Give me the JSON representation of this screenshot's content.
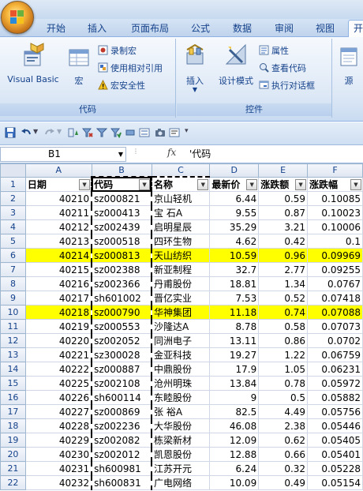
{
  "ribbon_tabs": [
    {
      "label": "开始"
    },
    {
      "label": "插入"
    },
    {
      "label": "页面布局"
    },
    {
      "label": "公式"
    },
    {
      "label": "数据"
    },
    {
      "label": "审阅"
    },
    {
      "label": "视图"
    },
    {
      "label": "开"
    }
  ],
  "ribbon": {
    "code_group": {
      "label": "代码",
      "visual_basic": "Visual Basic",
      "macros": "宏",
      "record_macro": "录制宏",
      "relative_ref": "使用相对引用",
      "macro_security": "宏安全性"
    },
    "controls_group": {
      "label": "控件",
      "insert": "插入",
      "design_mode": "设计模式",
      "properties": "属性",
      "view_code": "查看代码",
      "run_dialog": "执行对话框"
    },
    "source_group": {
      "source": "源"
    }
  },
  "formula_bar": {
    "name_box": "B1",
    "fx": "fx",
    "formula": "'代码"
  },
  "columns": [
    "A",
    "B",
    "C",
    "D",
    "E",
    "F"
  ],
  "headers": [
    "日期",
    "代码",
    "名称",
    "最新价",
    "涨跌额",
    "涨跌幅"
  ],
  "rows": [
    {
      "n": "2",
      "cells": [
        "40210",
        "sz000821",
        "京山轻机",
        "6.44",
        "0.59",
        "0.10085"
      ],
      "hl": false
    },
    {
      "n": "3",
      "cells": [
        "40211",
        "sz000413",
        "宝 石A",
        "9.55",
        "0.87",
        "0.10023"
      ],
      "hl": false
    },
    {
      "n": "4",
      "cells": [
        "40212",
        "sz002439",
        "启明星辰",
        "35.29",
        "3.21",
        "0.10006"
      ],
      "hl": false
    },
    {
      "n": "5",
      "cells": [
        "40213",
        "sz000518",
        "四环生物",
        "4.62",
        "0.42",
        "0.1"
      ],
      "hl": false
    },
    {
      "n": "6",
      "cells": [
        "40214",
        "sz000813",
        "天山纺织",
        "10.59",
        "0.96",
        "0.09969"
      ],
      "hl": true
    },
    {
      "n": "7",
      "cells": [
        "40215",
        "sz002388",
        "新亚制程",
        "32.7",
        "2.77",
        "0.09255"
      ],
      "hl": false
    },
    {
      "n": "8",
      "cells": [
        "40216",
        "sz002366",
        "丹甫股份",
        "18.81",
        "1.34",
        "0.0767"
      ],
      "hl": false
    },
    {
      "n": "9",
      "cells": [
        "40217",
        "sh601002",
        "晋亿实业",
        "7.53",
        "0.52",
        "0.07418"
      ],
      "hl": false
    },
    {
      "n": "10",
      "cells": [
        "40218",
        "sz000790",
        "华神集团",
        "11.18",
        "0.74",
        "0.07088"
      ],
      "hl": true
    },
    {
      "n": "11",
      "cells": [
        "40219",
        "sz000553",
        "沙隆达A",
        "8.78",
        "0.58",
        "0.07073"
      ],
      "hl": false
    },
    {
      "n": "12",
      "cells": [
        "40220",
        "sz002052",
        "同洲电子",
        "13.11",
        "0.86",
        "0.0702"
      ],
      "hl": false
    },
    {
      "n": "13",
      "cells": [
        "40221",
        "sz300028",
        "金亚科技",
        "19.27",
        "1.22",
        "0.06759"
      ],
      "hl": false
    },
    {
      "n": "14",
      "cells": [
        "40222",
        "sz000887",
        "中鼎股份",
        "17.9",
        "1.05",
        "0.06231"
      ],
      "hl": false
    },
    {
      "n": "15",
      "cells": [
        "40225",
        "sz002108",
        "沧州明珠",
        "13.84",
        "0.78",
        "0.05972"
      ],
      "hl": false
    },
    {
      "n": "16",
      "cells": [
        "40226",
        "sh600114",
        "东睦股份",
        "9",
        "0.5",
        "0.05882"
      ],
      "hl": false
    },
    {
      "n": "17",
      "cells": [
        "40227",
        "sz000869",
        "张 裕A",
        "82.5",
        "4.49",
        "0.05756"
      ],
      "hl": false
    },
    {
      "n": "18",
      "cells": [
        "40228",
        "sz002236",
        "大华股份",
        "46.08",
        "2.38",
        "0.05446"
      ],
      "hl": false
    },
    {
      "n": "19",
      "cells": [
        "40229",
        "sz002082",
        "栋梁新材",
        "12.09",
        "0.62",
        "0.05405"
      ],
      "hl": false
    },
    {
      "n": "20",
      "cells": [
        "40230",
        "sz002012",
        "凯恩股份",
        "12.88",
        "0.66",
        "0.05401"
      ],
      "hl": false
    },
    {
      "n": "21",
      "cells": [
        "40231",
        "sh600981",
        "江苏开元",
        "6.24",
        "0.32",
        "0.05228"
      ],
      "hl": false
    },
    {
      "n": "22",
      "cells": [
        "40232",
        "sh600831",
        "广电网络",
        "10.09",
        "0.49",
        "0.05154"
      ],
      "hl": false
    }
  ],
  "colors": {
    "highlight": "#ffff00",
    "ribbon_text": "#15428b"
  }
}
